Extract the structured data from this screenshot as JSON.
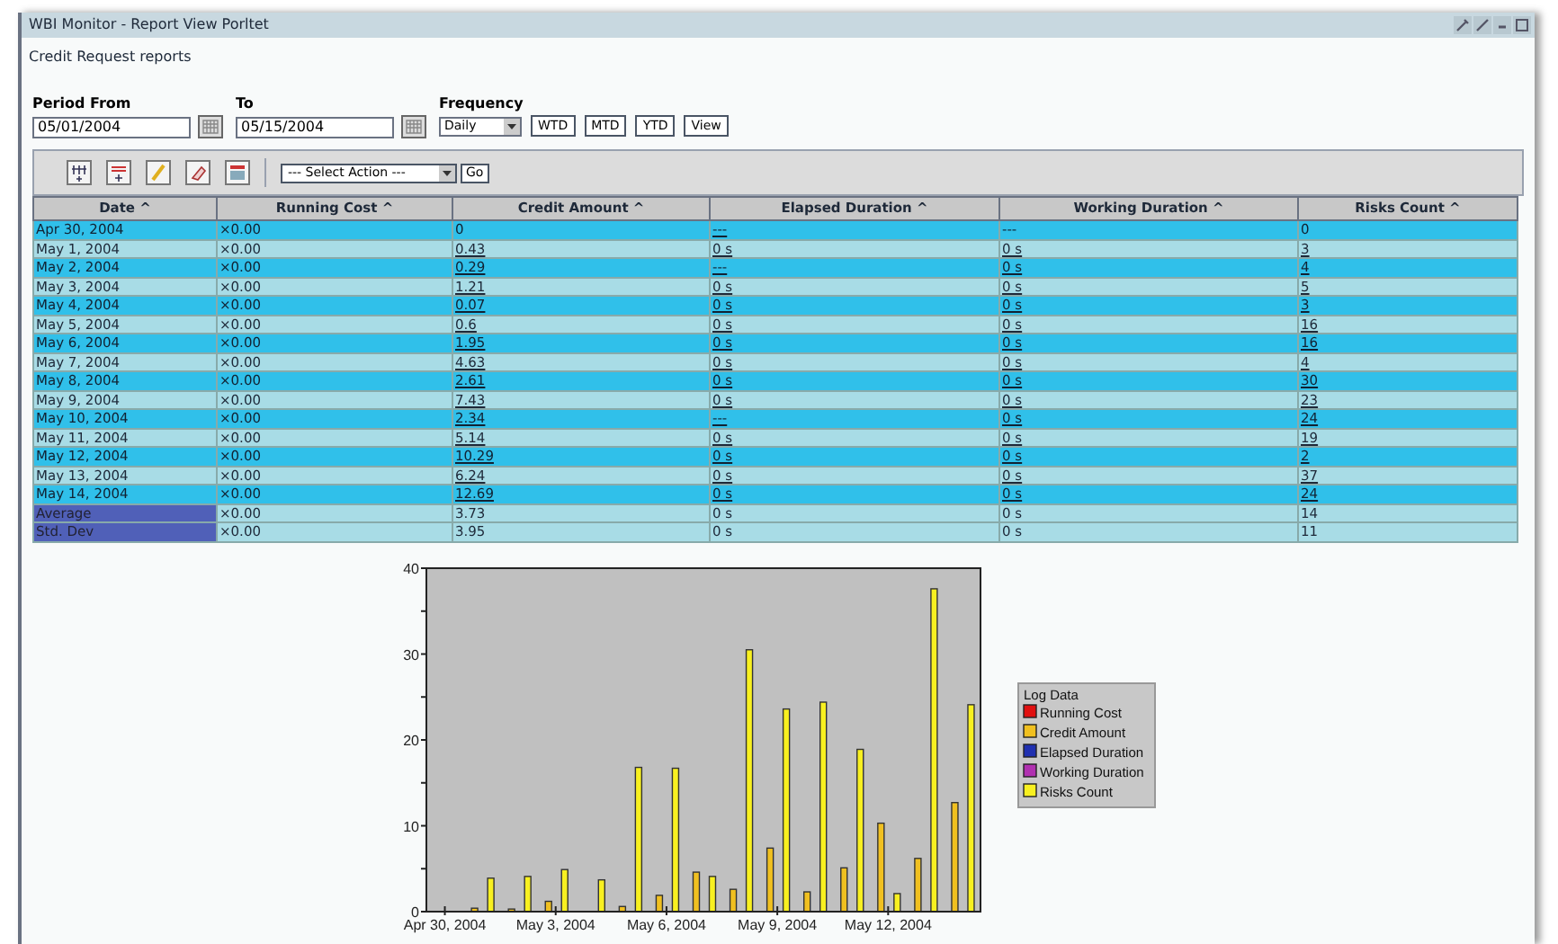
{
  "window": {
    "title": "WBI Monitor - Report View Porltet"
  },
  "subtitle": "Credit Request reports",
  "filters": {
    "from_label": "Period From",
    "from_value": "05/01/2004",
    "to_label": "To",
    "to_value": "05/15/2004",
    "frequency_label": "Frequency",
    "frequency_value": "Daily",
    "buttons": [
      "WTD",
      "MTD",
      "YTD",
      "View"
    ]
  },
  "toolbar": {
    "action_value": "--- Select Action ---",
    "go": "Go"
  },
  "table": {
    "columns": [
      "Date ^",
      "Running Cost ^",
      "Credit Amount ^",
      "Elapsed Duration ^",
      "Working Duration ^",
      "Risks Count ^"
    ],
    "rows": [
      {
        "kind": "data",
        "cells": [
          "Apr 30, 2004",
          "×0.00",
          "0",
          "---",
          "---",
          "0"
        ]
      },
      {
        "kind": "data",
        "cells": [
          "May 1, 2004",
          "×0.00",
          "0.43",
          "0 s",
          "0 s",
          "3"
        ]
      },
      {
        "kind": "data",
        "cells": [
          "May 2, 2004",
          "×0.00",
          "0.29",
          "---",
          "0 s",
          "4"
        ]
      },
      {
        "kind": "data",
        "cells": [
          "May 3, 2004",
          "×0.00",
          "1.21",
          "0 s",
          "0 s",
          "5"
        ]
      },
      {
        "kind": "data",
        "cells": [
          "May 4, 2004",
          "×0.00",
          "0.07",
          "0 s",
          "0 s",
          "3"
        ]
      },
      {
        "kind": "data",
        "cells": [
          "May 5, 2004",
          "×0.00",
          "0.6",
          "0 s",
          "0 s",
          "16"
        ]
      },
      {
        "kind": "data",
        "cells": [
          "May 6, 2004",
          "×0.00",
          "1.95",
          "0 s",
          "0 s",
          "16"
        ]
      },
      {
        "kind": "data",
        "cells": [
          "May 7, 2004",
          "×0.00",
          "4.63",
          "0 s",
          "0 s",
          "4"
        ]
      },
      {
        "kind": "data",
        "cells": [
          "May 8, 2004",
          "×0.00",
          "2.61",
          "0 s",
          "0 s",
          "30"
        ]
      },
      {
        "kind": "data",
        "cells": [
          "May 9, 2004",
          "×0.00",
          "7.43",
          "0 s",
          "0 s",
          "23"
        ]
      },
      {
        "kind": "data",
        "cells": [
          "May 10, 2004",
          "×0.00",
          "2.34",
          "---",
          "0 s",
          "24"
        ]
      },
      {
        "kind": "data",
        "cells": [
          "May 11, 2004",
          "×0.00",
          "5.14",
          "0 s",
          "0 s",
          "19"
        ]
      },
      {
        "kind": "data",
        "cells": [
          "May 12, 2004",
          "×0.00",
          "10.29",
          "0 s",
          "0 s",
          "2"
        ]
      },
      {
        "kind": "data",
        "cells": [
          "May 13, 2004",
          "×0.00",
          "6.24",
          "0 s",
          "0 s",
          "37"
        ]
      },
      {
        "kind": "data",
        "cells": [
          "May 14, 2004",
          "×0.00",
          "12.69",
          "0 s",
          "0 s",
          "24"
        ]
      },
      {
        "kind": "summary",
        "cells": [
          "Average",
          "×0.00",
          "3.73",
          "0 s",
          "0 s",
          "14"
        ]
      },
      {
        "kind": "summary",
        "cells": [
          "Std. Dev",
          "×0.00",
          "3.95",
          "0 s",
          "0 s",
          "11"
        ]
      }
    ]
  },
  "chart": {
    "chart_data": {
      "type": "bar",
      "legend": {
        "title": "Log Data"
      },
      "categories": [
        "Apr 30, 2004",
        null,
        null,
        "May 3, 2004",
        null,
        null,
        "May 6, 2004",
        null,
        null,
        "May 9, 2004",
        null,
        null,
        "May 12, 2004",
        null,
        null
      ],
      "ylim": [
        0,
        40
      ],
      "yticks": [
        0,
        10,
        20,
        30,
        40
      ],
      "series": [
        {
          "name": "Running Cost",
          "color": "#e01010",
          "values": [
            0,
            0,
            0,
            0,
            0,
            0,
            0,
            0,
            0,
            0,
            0,
            0,
            0,
            0,
            0
          ]
        },
        {
          "name": "Credit Amount",
          "color": "#f0c020",
          "values": [
            0,
            0.4,
            0.3,
            1.2,
            null,
            0.6,
            1.9,
            4.6,
            2.6,
            7.4,
            2.3,
            5.1,
            10.3,
            6.2,
            12.7
          ]
        },
        {
          "name": "Elapsed Duration",
          "color": "#2030b0",
          "values": [
            0,
            0,
            0,
            0,
            0,
            0,
            0,
            0,
            0,
            0,
            0,
            0,
            0,
            0,
            0
          ]
        },
        {
          "name": "Working Duration",
          "color": "#b030b0",
          "values": [
            0,
            0,
            0,
            0,
            0,
            0,
            0,
            0,
            0,
            0,
            0,
            0,
            0,
            0,
            0
          ]
        },
        {
          "name": "Risks Count",
          "color": "#f8f020",
          "values": [
            0,
            3.9,
            4.1,
            4.9,
            3.7,
            16.8,
            16.7,
            4.1,
            30.5,
            23.6,
            24.4,
            18.9,
            2.1,
            37.6,
            24.1
          ]
        }
      ]
    }
  }
}
